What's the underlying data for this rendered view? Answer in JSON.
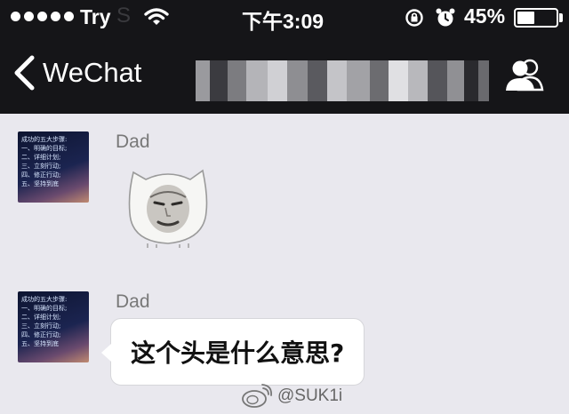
{
  "status_bar": {
    "carrier": "Try",
    "carrier_suffix": "S",
    "time": "下午3:09",
    "battery_percent": "45%",
    "battery_level": 0.45,
    "signal_dots": 5
  },
  "nav": {
    "back_label": "WeChat",
    "title_blurred": true
  },
  "messages": [
    {
      "sender": "Dad",
      "type": "sticker",
      "sticker": "white-bear-face-sticker"
    },
    {
      "sender": "Dad",
      "type": "text",
      "text": "这个头是什么意思?"
    }
  ],
  "avatar_text": [
    "成功的五大步骤:",
    "一、明确的目标;",
    "二、详细计划;",
    "三、立刻行动;",
    "四、修正行动;",
    "五、坚持到底"
  ],
  "watermark": {
    "text": "@SUK1i"
  },
  "colors": {
    "topbar": "#151518",
    "chat_bg": "#e9e8ee",
    "bubble": "#ffffff",
    "sender": "#787878"
  }
}
